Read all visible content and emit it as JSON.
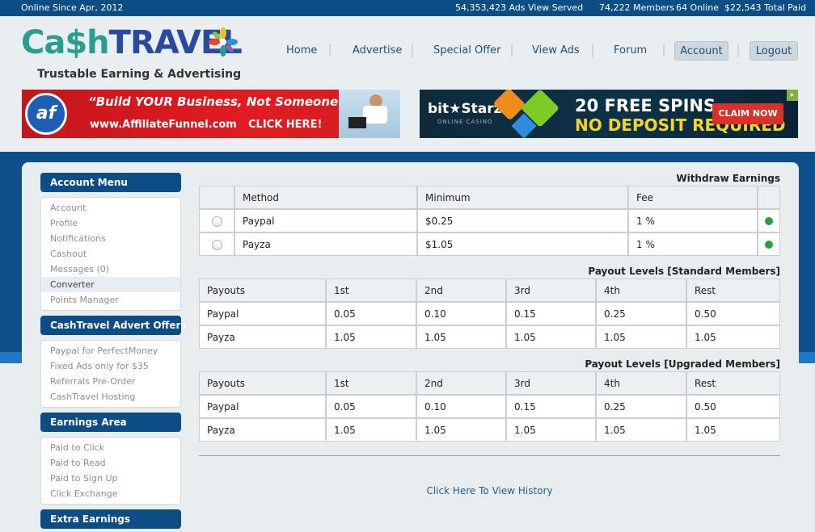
{
  "topbar": {
    "online_since": "Online Since Apr, 2012",
    "ads_served": "54,353,423 Ads View Served",
    "members": "74,222 Members",
    "online": "64 Online",
    "total_paid": "$22,543 Total Paid"
  },
  "logo": {
    "cash": "Ca$h",
    "travel": "TRAVEL",
    "tagline": "Trustable Earning & Advertising"
  },
  "nav": {
    "home": "Home",
    "advertise": "Advertise",
    "special_offer": "Special Offer",
    "view_ads": "View Ads",
    "forum": "Forum",
    "account": "Account",
    "logout": "Logout"
  },
  "banners": {
    "af": {
      "logo": "af",
      "slogan": "“Build YOUR Business, Not Someone Else’s”",
      "url": "www.AffiliateFunnel.com",
      "cta": "CLICK HERE!"
    },
    "bitstarz": {
      "brand": "bit★Starz",
      "sub": "ONLINE CASINO",
      "headline": "20 FREE SPINS",
      "subline": "NO DEPOSIT REQUIRED",
      "cta": "CLAIM NOW"
    }
  },
  "sidebar": {
    "sections": [
      {
        "title": "Account Menu",
        "items": [
          "Account",
          "Profile",
          "Notifications",
          "Cashout",
          "Messages (0)",
          "Converter",
          "Points Manager"
        ]
      },
      {
        "title": "CashTravel Advert Offers",
        "items": [
          "Paypal for PerfectMoney",
          "Fixed Ads only for $35",
          "Referrals Pre-Order",
          "CashTravel Hosting"
        ]
      },
      {
        "title": "Earnings Area",
        "items": [
          "Paid to Click",
          "Paid to Read",
          "Paid to Sign Up",
          "Click Exchange"
        ]
      },
      {
        "title": "Extra Earnings",
        "items": []
      }
    ]
  },
  "withdraw": {
    "title": "Withdraw Earnings",
    "headers": [
      "Method",
      "Minimum",
      "Fee"
    ],
    "rows": [
      {
        "method": "Paypal",
        "minimum": "$0.25",
        "fee": "1 %"
      },
      {
        "method": "Payza",
        "minimum": "$1.05",
        "fee": "1 %"
      }
    ]
  },
  "payout_standard": {
    "title": "Payout Levels [Standard Members]",
    "headers": [
      "Payouts",
      "1st",
      "2nd",
      "3rd",
      "4th",
      "Rest"
    ],
    "rows": [
      [
        "Paypal",
        "0.05",
        "0.10",
        "0.15",
        "0.25",
        "0.50"
      ],
      [
        "Payza",
        "1.05",
        "1.05",
        "1.05",
        "1.05",
        "1.05"
      ]
    ]
  },
  "payout_upgraded": {
    "title": "Payout Levels [Upgraded Members]",
    "headers": [
      "Payouts",
      "1st",
      "2nd",
      "3rd",
      "4th",
      "Rest"
    ],
    "rows": [
      [
        "Paypal",
        "0.05",
        "0.10",
        "0.15",
        "0.25",
        "0.50"
      ],
      [
        "Payza",
        "1.05",
        "1.05",
        "1.05",
        "1.05",
        "1.05"
      ]
    ]
  },
  "history_link": "Click Here To View History",
  "colors": {
    "brand_blue": "#0d4d86",
    "accent_blue": "#1e78c4",
    "status_green": "#22a33a",
    "logo_teal": "#2a9d8f"
  }
}
